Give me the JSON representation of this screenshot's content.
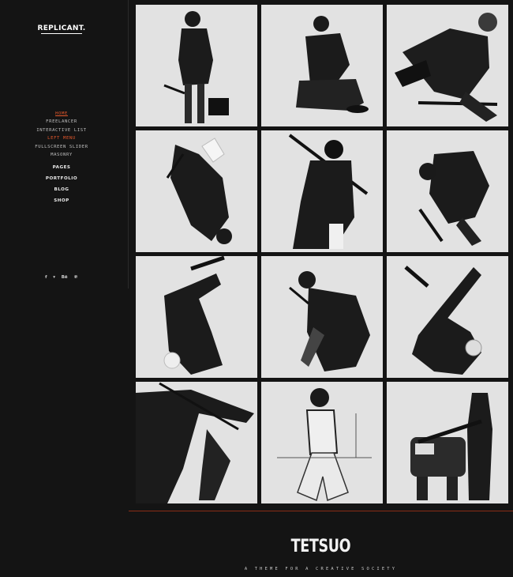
{
  "brand": {
    "logo": "REPLICANT."
  },
  "menu": {
    "home": "HOME",
    "sub_items": [
      {
        "label": "FREELANCER"
      },
      {
        "label": "INTERACTIVE LIST"
      },
      {
        "label": "LEFT MENU"
      },
      {
        "label": "FULLSCREEN SLIDER"
      },
      {
        "label": "MASONRY"
      }
    ],
    "main_items": [
      {
        "label": "PAGES"
      },
      {
        "label": "PORTFOLIO"
      },
      {
        "label": "BLOG"
      },
      {
        "label": "SHOP"
      }
    ]
  },
  "social": [
    {
      "icon": "facebook-icon",
      "glyph": "f"
    },
    {
      "icon": "twitter-icon",
      "glyph": "▾"
    },
    {
      "icon": "behance-icon",
      "glyph": "Bē"
    },
    {
      "icon": "pinterest-icon",
      "glyph": "℗"
    }
  ],
  "gallery": [
    {
      "name": "portfolio-tile-1",
      "subject": "figure-standing-with-bag"
    },
    {
      "name": "portfolio-tile-2",
      "subject": "figure-sitting-crouched"
    },
    {
      "name": "portfolio-tile-3",
      "subject": "figure-leaping-mask"
    },
    {
      "name": "portfolio-tile-4",
      "subject": "figure-upside-down-falling"
    },
    {
      "name": "portfolio-tile-5",
      "subject": "figure-hooded-with-staff"
    },
    {
      "name": "portfolio-tile-6",
      "subject": "figure-tumbling"
    },
    {
      "name": "portfolio-tile-7",
      "subject": "figure-handstand-kick"
    },
    {
      "name": "portfolio-tile-8",
      "subject": "figure-crouching-jacket"
    },
    {
      "name": "portfolio-tile-9",
      "subject": "figure-inverted-leg-up"
    },
    {
      "name": "portfolio-tile-10",
      "subject": "figure-wide-hat-sword"
    },
    {
      "name": "portfolio-tile-11",
      "subject": "figure-kneeling-harness"
    },
    {
      "name": "portfolio-tile-12",
      "subject": "figure-with-robot"
    }
  ],
  "footer": {
    "logo": "TETSUO",
    "tagline": "A THEME FOR A CREATIVE SOCIETY"
  },
  "colors": {
    "background": "#141414",
    "accent": "#e2572b",
    "tile": "#dedede",
    "divider": "#8b2e16"
  }
}
